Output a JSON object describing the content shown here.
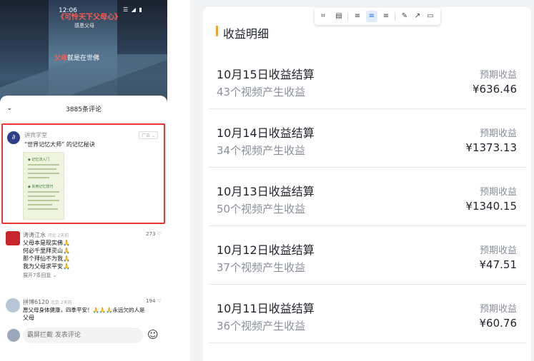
{
  "phone": {
    "status_time": "12:06",
    "status_icons": "☰ ◢ ▮",
    "video_title": "《可怜天下父母心》",
    "video_subtitle": "感恩父母",
    "video_caption_emph": "父母",
    "video_caption_rest": "就是在世佛",
    "comment_count": "3885条评论",
    "ad": {
      "name": "讲宾学堂",
      "badge": "广告 ⌄",
      "text": "“世界记忆大师” 的记忆秘诀",
      "avatar_glyph": "∂",
      "image_heading1": "◆ 记忆法入门",
      "image_heading2": "◆ 实用记忆技巧"
    },
    "comments": [
      {
        "name": "涛涛江水",
        "meta": "河北 2天前",
        "likes": "273 ♡",
        "lines": [
          "父母本是现实佛🙏",
          "何必千里拜灵山🙏",
          "那个拜仙不为我🙏",
          "我为父母求平安🙏"
        ],
        "expand": "展开7条回复 ⌄"
      },
      {
        "name": "拼博6120",
        "meta": "北京 2天前",
        "likes": "194 ♡",
        "lines": [
          "愿父母身体健康，四季平安！🙏🙏🙏永远欠的人是",
          "父母"
        ]
      }
    ],
    "input_placeholder": "霸屏拦截 发表评论",
    "colors": {
      "highlight_border": "#ee3333",
      "caption_red": "#ff5a4a"
    }
  },
  "panel": {
    "title": "收益明细",
    "accent_color": "#f0a23b",
    "rows": [
      {
        "title": "10月15日收益结算",
        "subtitle": "43个视频产生收益",
        "label": "预期收益",
        "amount": "¥636.46"
      },
      {
        "title": "10月14日收益结算",
        "subtitle": "34个视频产生收益",
        "label": "预期收益",
        "amount": "¥1373.13"
      },
      {
        "title": "10月13日收益结算",
        "subtitle": "50个视频产生收益",
        "label": "预期收益",
        "amount": "¥1340.15"
      },
      {
        "title": "10月12日收益结算",
        "subtitle": "37个视频产生收益",
        "label": "预期收益",
        "amount": "¥47.51"
      },
      {
        "title": "10月11日收益结算",
        "subtitle": "36个视频产生收益",
        "label": "预期收益",
        "amount": "¥60.76"
      }
    ],
    "toolbar": {
      "crop": "⌗",
      "note": "▤",
      "align_left": "≡",
      "align_center": "≡",
      "align_right": "≡",
      "edit": "✎",
      "share": "↗",
      "comment": "▭"
    }
  }
}
